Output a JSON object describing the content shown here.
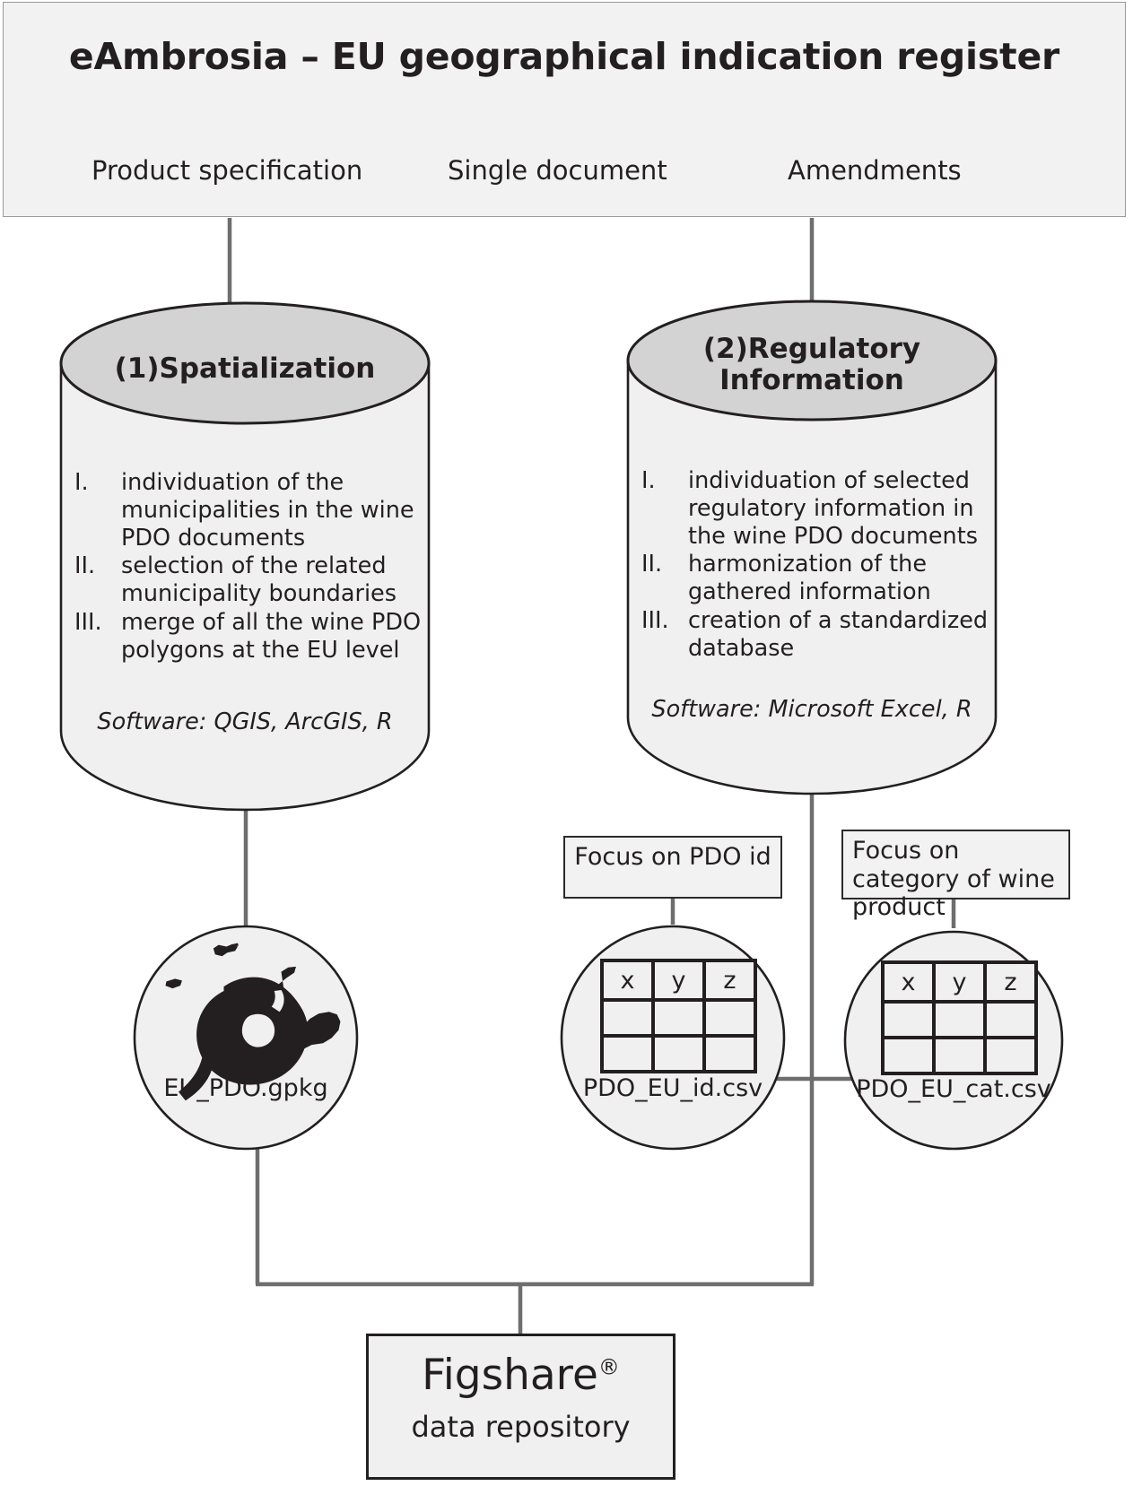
{
  "header": {
    "title": "eAmbrosia – EU geographical indication register",
    "sources": [
      {
        "label": "Product specification"
      },
      {
        "label": "Single document"
      },
      {
        "label": "Amendments"
      }
    ]
  },
  "cylinders": [
    {
      "title": "(1)Spatialization",
      "steps": [
        {
          "num": "I.",
          "text": "individuation of the municipalities in the wine PDO documents"
        },
        {
          "num": "II.",
          "text": "selection of the related municipality boundaries"
        },
        {
          "num": "III.",
          "text": "merge of all the wine PDO polygons at the EU level"
        }
      ],
      "software": "Software: QGIS, ArcGIS, R"
    },
    {
      "title": "(2)Regulatory Information",
      "steps": [
        {
          "num": "I.",
          "text": "individuation of selected regulatory information in the wine PDO documents"
        },
        {
          "num": "II.",
          "text": "harmonization of the gathered information"
        },
        {
          "num": "III.",
          "text": "creation of a standardized database"
        }
      ],
      "software": "Software: Microsoft Excel, R"
    }
  ],
  "focus_boxes": [
    {
      "label": "Focus on PDO id"
    },
    {
      "label": "Focus on category of wine product"
    }
  ],
  "outputs": [
    {
      "label": "EU_PDO.gpkg",
      "icon": "europe-map-icon"
    },
    {
      "label": "PDO_EU_id.csv",
      "icon": "table-icon",
      "table": {
        "headers": [
          "x",
          "y",
          "z"
        ],
        "rows": [
          [
            "",
            "",
            ""
          ],
          [
            "",
            "",
            ""
          ]
        ]
      }
    },
    {
      "label": "PDO_EU_cat.csv",
      "icon": "table-icon",
      "table": {
        "headers": [
          "x",
          "y",
          "z"
        ],
        "rows": [
          [
            "",
            "",
            ""
          ],
          [
            "",
            "",
            ""
          ]
        ]
      }
    }
  ],
  "repository": {
    "name": "Figshare",
    "trademark": "®",
    "subtitle": "data repository"
  },
  "colors": {
    "panel_fill": "#f2f2f2",
    "cylinder_top_fill": "#d3d3d3",
    "cylinder_body_fill": "#f0f0f0",
    "stroke_dark": "#231f20",
    "connector": "#6e6e6e"
  }
}
